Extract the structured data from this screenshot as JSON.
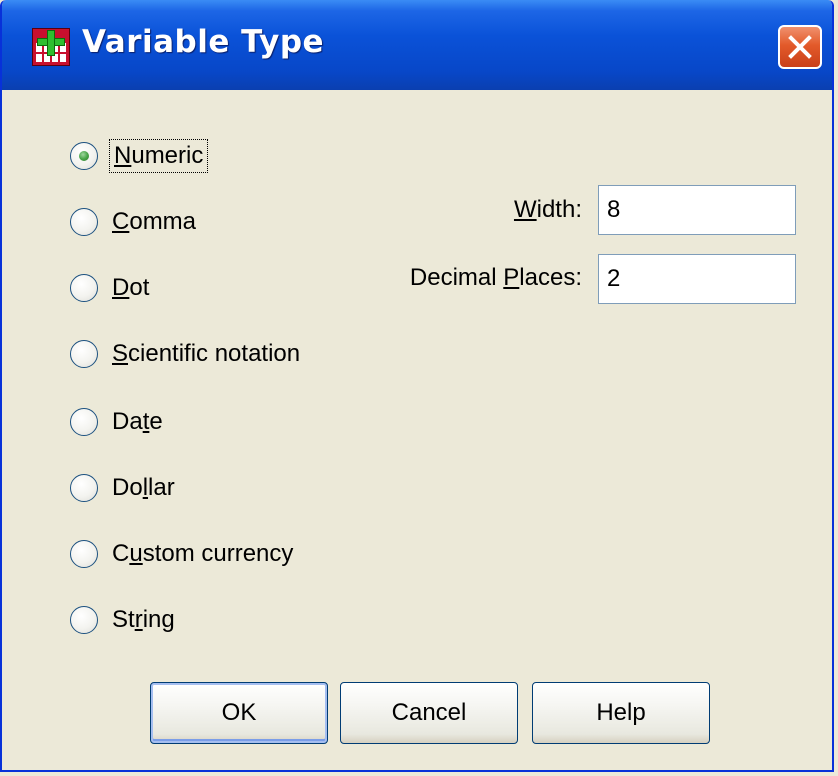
{
  "window": {
    "title": "Variable Type",
    "icon": "spss-data-editor-icon",
    "close_icon": "close-x-icon"
  },
  "types": [
    {
      "pre": "",
      "u": "N",
      "post": "umeric",
      "checked": true
    },
    {
      "pre": "",
      "u": "C",
      "post": "omma",
      "checked": false
    },
    {
      "pre": "",
      "u": "D",
      "post": "ot",
      "checked": false
    },
    {
      "pre": "",
      "u": "S",
      "post": "cientific notation",
      "checked": false
    },
    {
      "pre": "Da",
      "u": "t",
      "post": "e",
      "checked": false
    },
    {
      "pre": "Do",
      "u": "l",
      "post": "lar",
      "checked": false
    },
    {
      "pre": "C",
      "u": "u",
      "post": "stom currency",
      "checked": false
    },
    {
      "pre": "St",
      "u": "r",
      "post": "ing",
      "checked": false
    }
  ],
  "fields": {
    "width": {
      "label_u": "W",
      "label_post": "idth:",
      "value": "8"
    },
    "decimals": {
      "label_pre": "Decimal ",
      "label_u": "P",
      "label_post": "laces:",
      "value": "2"
    }
  },
  "buttons": {
    "ok": "OK",
    "cancel": "Cancel",
    "help": "Help"
  },
  "colors": {
    "title_bar": "#0a52d8",
    "dialog_bg": "#ece9d8",
    "close_button": "#e35a2a",
    "radio_selected": "#4aa64a"
  }
}
